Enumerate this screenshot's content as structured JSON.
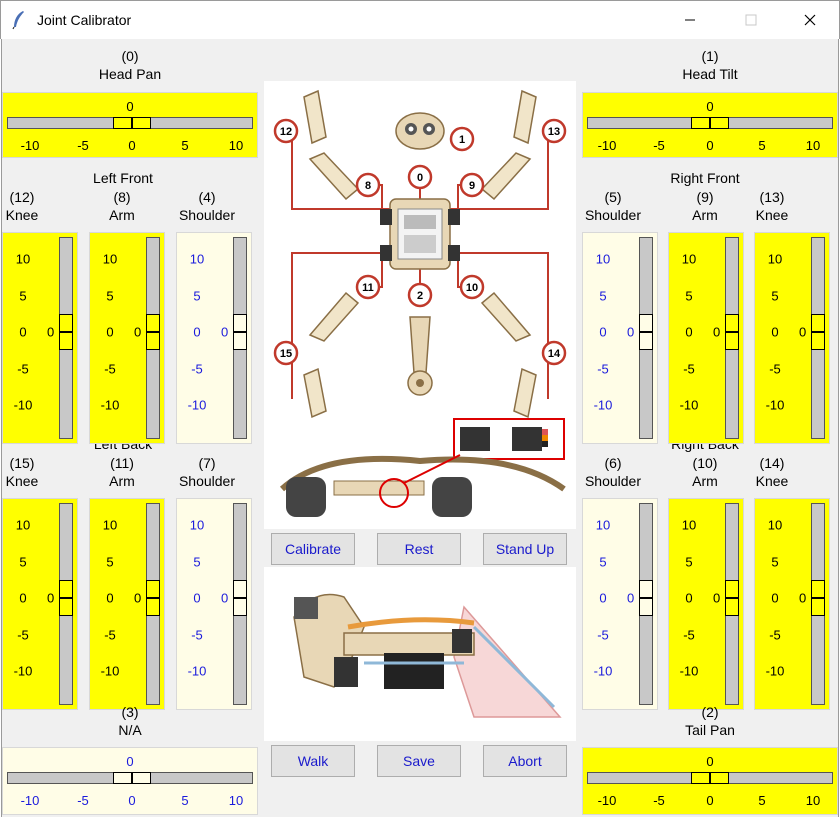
{
  "window": {
    "title": "Joint Calibrator"
  },
  "colors": {
    "active_scale": "#ffff00",
    "inactive_scale": "#fffde7",
    "button_text": "#1a1acc",
    "wire": "#c0392b"
  },
  "scale_ticks": {
    "horizontal": [
      "-10",
      "-5",
      "0",
      "5",
      "10"
    ],
    "vertical": [
      "10",
      "5",
      "0",
      "-5",
      "-10"
    ]
  },
  "top": {
    "head_pan": {
      "index": "(0)",
      "name": "Head Pan",
      "value": "0"
    },
    "head_tilt": {
      "index": "(1)",
      "name": "Head Tilt",
      "value": "0"
    }
  },
  "bottom": {
    "na": {
      "index": "(3)",
      "name": "N/A",
      "value": "0"
    },
    "tail_pan": {
      "index": "(2)",
      "name": "Tail Pan",
      "value": "0"
    }
  },
  "groups": {
    "left_front": "Left Front",
    "right_front": "Right Front",
    "left_back": "Left Back",
    "right_back": "Right Back"
  },
  "joints": {
    "lf_knee": {
      "index": "(12)",
      "name": "Knee",
      "value": "0"
    },
    "lf_arm": {
      "index": "(8)",
      "name": "Arm",
      "value": "0"
    },
    "lf_shoulder": {
      "index": "(4)",
      "name": "Shoulder",
      "value": "0"
    },
    "rf_shoulder": {
      "index": "(5)",
      "name": "Shoulder",
      "value": "0"
    },
    "rf_arm": {
      "index": "(9)",
      "name": "Arm",
      "value": "0"
    },
    "rf_knee": {
      "index": "(13)",
      "name": "Knee",
      "value": "0"
    },
    "lb_knee": {
      "index": "(15)",
      "name": "Knee",
      "value": "0"
    },
    "lb_arm": {
      "index": "(11)",
      "name": "Arm",
      "value": "0"
    },
    "lb_shoulder": {
      "index": "(7)",
      "name": "Shoulder",
      "value": "0"
    },
    "rb_shoulder": {
      "index": "(6)",
      "name": "Shoulder",
      "value": "0"
    },
    "rb_arm": {
      "index": "(10)",
      "name": "Arm",
      "value": "0"
    },
    "rb_knee": {
      "index": "(14)",
      "name": "Knee",
      "value": "0"
    }
  },
  "diagram": {
    "servo_numbers": [
      "0",
      "1",
      "2",
      "8",
      "9",
      "10",
      "11",
      "12",
      "13",
      "14",
      "15"
    ]
  },
  "buttons": {
    "calibrate": "Calibrate",
    "rest": "Rest",
    "stand_up": "Stand Up",
    "walk": "Walk",
    "save": "Save",
    "abort": "Abort"
  }
}
